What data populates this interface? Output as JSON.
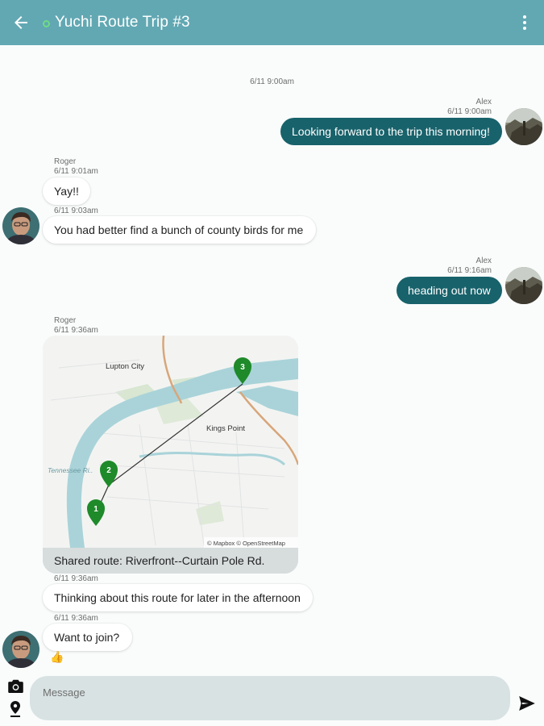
{
  "header": {
    "title": "Yuchi Route Trip #3",
    "back_icon": "arrow-back-icon",
    "menu_icon": "more-vert-icon",
    "status_color": "#6ddc85",
    "bar_color": "#62a8b3"
  },
  "messages": {
    "date_divider": "6/11 9:00am",
    "m1": {
      "sender": "Alex",
      "time": "6/11 9:00am",
      "text": "Looking forward to the trip this morning!"
    },
    "m2": {
      "sender": "Roger",
      "time": "6/11 9:01am",
      "text": "Yay!!"
    },
    "m3": {
      "time": "6/11 9:03am",
      "text": "You had better find a bunch of county birds for me"
    },
    "m4": {
      "sender": "Alex",
      "time": "6/11 9:16am",
      "text": "heading out now"
    },
    "m5": {
      "sender": "Roger",
      "time": "6/11 9:36am",
      "map": {
        "labels": {
          "city1": "Lupton City",
          "city2": "Kings Point",
          "river": "Tennessee Ri..",
          "attribution": "© Mapbox © OpenStreetMap"
        },
        "markers": [
          "1",
          "2",
          "3"
        ],
        "marker_color": "#1e8a2a"
      },
      "caption": "Shared route: Riverfront--Curtain Pole Rd."
    },
    "m6": {
      "time": "6/11 9:36am",
      "text": "Thinking about this route for later in the afternoon"
    },
    "m7": {
      "time": "6/11 9:36am",
      "text": "Want to join?",
      "reaction": "👍"
    }
  },
  "composer": {
    "placeholder": "Message",
    "camera_icon": "camera-icon",
    "location_icon": "location-pin-icon",
    "send_icon": "send-icon"
  },
  "colors": {
    "outgoing_bubble": "#18626b",
    "incoming_bubble": "#ffffff"
  }
}
